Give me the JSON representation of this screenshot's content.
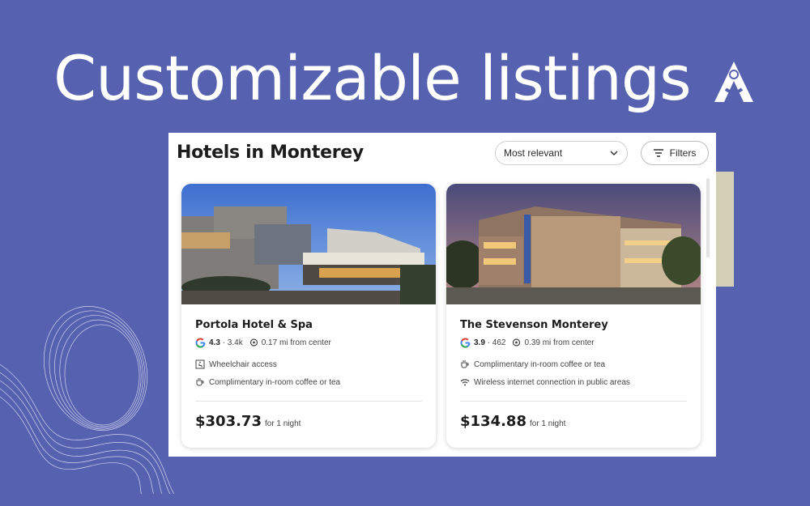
{
  "headline": "Customizable listings",
  "logo_icon": "a-logo-icon",
  "listing": {
    "title": "Hotels in Monterey",
    "sort": {
      "selected": "Most relevant"
    },
    "filters_label": "Filters"
  },
  "hotels": [
    {
      "name": "Portola Hotel & Spa",
      "rating": "4.3",
      "reviews": "3.4k",
      "distance": "0.17 mi from center",
      "amenities": [
        {
          "icon": "wheelchair-icon",
          "label": "Wheelchair access"
        },
        {
          "icon": "coffee-icon",
          "label": "Complimentary in-room coffee or tea"
        }
      ],
      "price": "$303.73",
      "price_note": "for 1 night"
    },
    {
      "name": "The Stevenson Monterey",
      "rating": "3.9",
      "reviews": "462",
      "distance": "0.39 mi from center",
      "amenities": [
        {
          "icon": "coffee-icon",
          "label": "Complimentary in-room coffee or tea"
        },
        {
          "icon": "wifi-icon",
          "label": "Wireless internet connection in public areas"
        }
      ],
      "price": "$134.88",
      "price_note": "for 1 night"
    }
  ],
  "colors": {
    "background": "#5661b0",
    "panel": "#ffffff",
    "accent_block": "#d4d0b8"
  }
}
